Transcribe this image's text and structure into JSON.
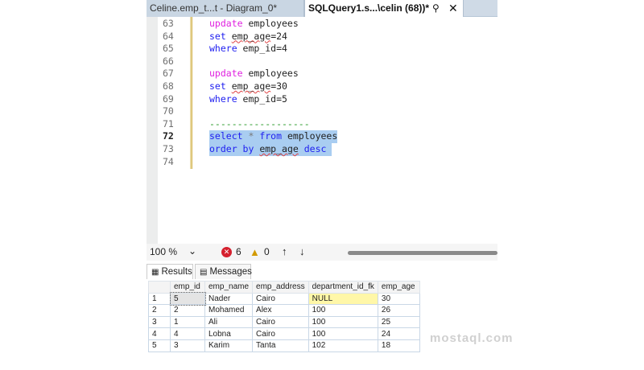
{
  "tabs": [
    {
      "label": "Celine.emp_t...t - Diagram_0*"
    },
    {
      "label": "SQLQuery1.s...\\celin (68))*",
      "pin": "📌",
      "close": "✕"
    }
  ],
  "editor": {
    "lines": [
      {
        "n": "63",
        "tokens": [
          {
            "t": "update",
            "c": "kwp"
          },
          {
            "t": " employees",
            "c": "id"
          }
        ]
      },
      {
        "n": "64",
        "tokens": [
          {
            "t": "set",
            "c": "kwb"
          },
          {
            "t": " ",
            "c": "id"
          },
          {
            "t": "emp_age",
            "c": "id sq"
          },
          {
            "t": "=24",
            "c": "id"
          }
        ]
      },
      {
        "n": "65",
        "tokens": [
          {
            "t": "where",
            "c": "kwb"
          },
          {
            "t": " emp_id=4",
            "c": "id"
          }
        ]
      },
      {
        "n": "66",
        "tokens": []
      },
      {
        "n": "67",
        "tokens": [
          {
            "t": "update",
            "c": "kwp"
          },
          {
            "t": " employees",
            "c": "id"
          }
        ]
      },
      {
        "n": "68",
        "tokens": [
          {
            "t": "set",
            "c": "kwb"
          },
          {
            "t": " ",
            "c": "id"
          },
          {
            "t": "emp_age",
            "c": "id sq"
          },
          {
            "t": "=30",
            "c": "id"
          }
        ]
      },
      {
        "n": "69",
        "tokens": [
          {
            "t": "where",
            "c": "kwb"
          },
          {
            "t": " emp_id=5",
            "c": "id"
          }
        ]
      },
      {
        "n": "70",
        "tokens": []
      },
      {
        "n": "71",
        "tokens": [
          {
            "t": "------------------",
            "c": "cm"
          }
        ]
      },
      {
        "n": "72",
        "current": true,
        "selected": true,
        "tokens": [
          {
            "t": "select",
            "c": "kwb"
          },
          {
            "t": " * ",
            "c": "gr"
          },
          {
            "t": "from",
            "c": "kwb"
          },
          {
            "t": " employees",
            "c": "id"
          }
        ]
      },
      {
        "n": "73",
        "selected": true,
        "tokens": [
          {
            "t": "order by",
            "c": "kwb"
          },
          {
            "t": " ",
            "c": "id"
          },
          {
            "t": "emp_age",
            "c": "id sq"
          },
          {
            "t": " desc ",
            "c": "kwb"
          }
        ]
      },
      {
        "n": "74",
        "tokens": []
      }
    ]
  },
  "toolbar": {
    "zoom": "100 %",
    "errors": "6",
    "warnings": "0"
  },
  "results_tabs": {
    "results": "Results",
    "messages": "Messages"
  },
  "grid": {
    "columns": [
      "emp_id",
      "emp_name",
      "emp_address",
      "department_id_fk",
      "emp_age"
    ],
    "rows": [
      [
        "1",
        "5",
        "Nader",
        "Cairo",
        "NULL",
        "30"
      ],
      [
        "2",
        "2",
        "Mohamed",
        "Alex",
        "100",
        "26"
      ],
      [
        "3",
        "1",
        "Ali",
        "Cairo",
        "100",
        "25"
      ],
      [
        "4",
        "4",
        "Lobna",
        "Cairo",
        "100",
        "24"
      ],
      [
        "5",
        "3",
        "Karim",
        "Tanta",
        "102",
        "18"
      ]
    ]
  },
  "watermark": "mostaql.com"
}
